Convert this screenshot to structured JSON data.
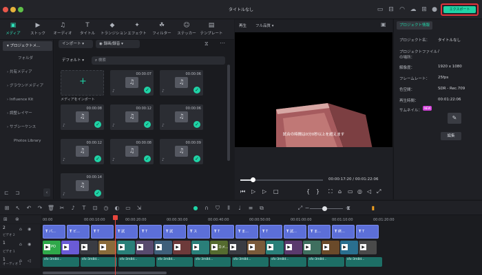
{
  "window": {
    "title": "タイトルなし",
    "export_label": "エクスポート"
  },
  "toolbar": {
    "tabs": [
      {
        "label": "メディア",
        "icon": "media-icon"
      },
      {
        "label": "ストック",
        "icon": "stock-icon"
      },
      {
        "label": "オーディオ",
        "icon": "music-icon"
      },
      {
        "label": "タイトル",
        "icon": "title-icon"
      },
      {
        "label": "トランジション",
        "icon": "transition-icon"
      },
      {
        "label": "エフェクト",
        "icon": "effect-icon"
      },
      {
        "label": "フィルター",
        "icon": "filter-icon"
      },
      {
        "label": "ステッカー",
        "icon": "sticker-icon"
      },
      {
        "label": "テンプレート",
        "icon": "template-icon"
      }
    ]
  },
  "sidebar": {
    "items": [
      "プロジェクトメ...",
      "フォルダ",
      "共有メディア",
      "グラウンドメディア",
      "Influence Kit",
      "調整レイヤー",
      "サブシーケンス",
      "Photos Library"
    ]
  },
  "media": {
    "import_label": "インポート",
    "record_label": "録画/録音",
    "sort_label": "デフォルト",
    "search_placeholder": "検索",
    "import_media_label": "メディアをインポート",
    "items": [
      {
        "duration": "00:00:07"
      },
      {
        "duration": "00:00:06"
      },
      {
        "duration": "00:00:08"
      },
      {
        "duration": "00:00:12"
      },
      {
        "duration": "00:00:06"
      },
      {
        "duration": "00:00:12"
      },
      {
        "duration": "00:00:08"
      },
      {
        "duration": "00:00:09"
      },
      {
        "duration": "00:00:14"
      }
    ]
  },
  "preview": {
    "tab_label": "再生",
    "quality": "フル品質",
    "subtitle": "試合の時間は0分0秒以上を超えます",
    "current_time": "00:00:17:20",
    "total_time": "00:01:22:06",
    "progress": 0.15
  },
  "properties": {
    "tab_label": "プロジェクト情報",
    "rows": [
      {
        "label": "プロジェクト名：",
        "value": "タイトルなし"
      },
      {
        "label": "プロジェクトファイルの場所：",
        "value": "/"
      },
      {
        "label": "解像度：",
        "value": "1920 x 1080"
      },
      {
        "label": "フレームレート：",
        "value": "25fps"
      },
      {
        "label": "色空間：",
        "value": "SDR - Rec.709"
      },
      {
        "label": "再生時間：",
        "value": "00:01:22:06"
      }
    ],
    "thumbnail_label": "サムネイル：",
    "new_badge": "NEW",
    "edit_label": "編集"
  },
  "timeline": {
    "ruler": [
      "00:00",
      "00:00:10:00",
      "00:00:20:00",
      "00:00:30:00",
      "00:00:40:00",
      "00:00:50:00",
      "00:01:00:00",
      "00:01:10:00",
      "00:01:20:00"
    ],
    "tracks": [
      {
        "name": "ビデオ 2",
        "number": "2"
      },
      {
        "name": "ビデオ 1",
        "number": "1"
      },
      {
        "name": "オーディオ 1",
        "number": "1"
      }
    ],
    "title_clips": [
      "パ...",
      "ビ...",
      "T",
      "試",
      "T",
      "試",
      "ス",
      "T",
      "ま...",
      "T",
      "試...",
      "ま...",
      "終...",
      "T"
    ],
    "video_clips": [
      "PO",
      "",
      "",
      "",
      "",
      "",
      "",
      "",
      "",
      "カメ...",
      "",
      "",
      "",
      "",
      "",
      "",
      "",
      ""
    ],
    "audio_label": "sfx-3m8d..."
  }
}
